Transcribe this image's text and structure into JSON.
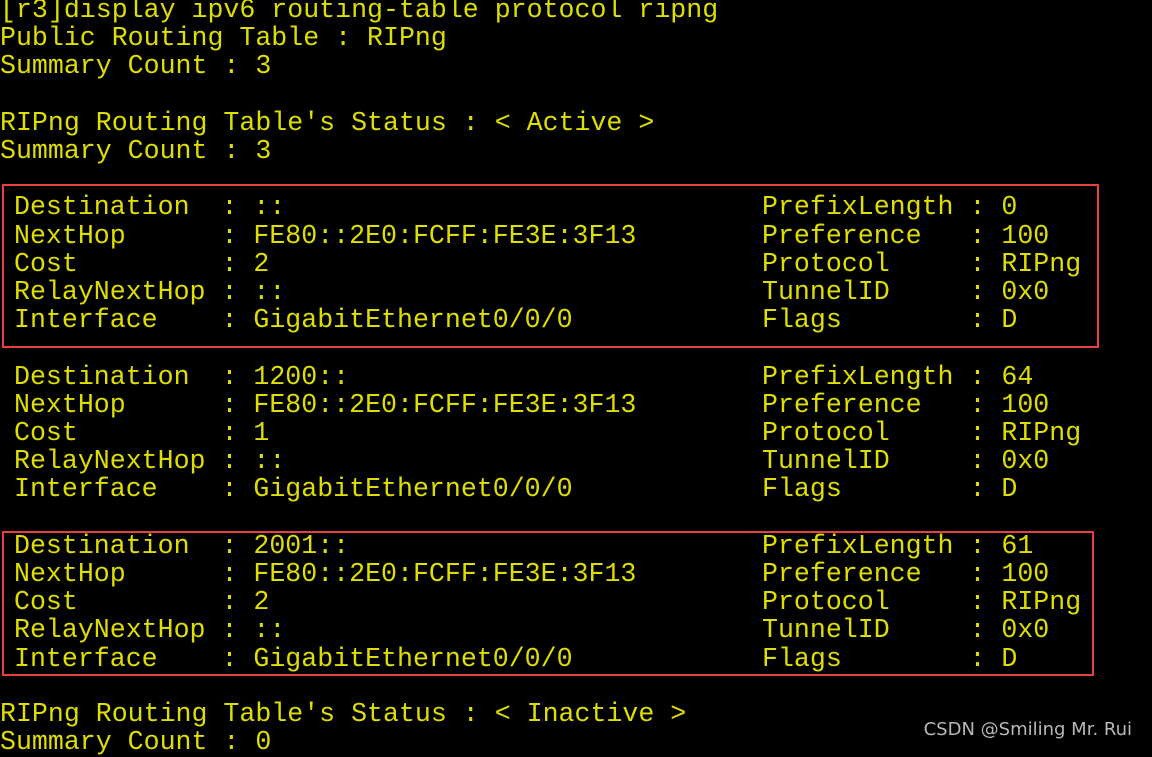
{
  "terminal": {
    "text_color": "#dede00",
    "background": "#000000",
    "highlight_box_color": "#e8403c",
    "command": "[r3]display ipv6 routing-table protocol ripng",
    "public_table": "Public Routing Table : RIPng",
    "summary_total": "Summary Count : 3",
    "active_status": "RIPng Routing Table's Status : < Active >",
    "active_summary": "Summary Count : 3",
    "inactive_status": "RIPng Routing Table's Status : < Inactive >",
    "inactive_summary": "Summary Count : 0",
    "entries": [
      {
        "highlighted": true,
        "rows": [
          [
            "Destination  : ::",
            "PrefixLength : 0"
          ],
          [
            "NextHop      : FE80::2E0:FCFF:FE3E:3F13",
            "Preference   : 100"
          ],
          [
            "Cost         : 2",
            "Protocol     : RIPng"
          ],
          [
            "RelayNextHop : ::",
            "TunnelID     : 0x0"
          ],
          [
            "Interface    : GigabitEthernet0/0/0",
            "Flags        : D"
          ]
        ]
      },
      {
        "highlighted": false,
        "rows": [
          [
            "Destination  : 1200::",
            "PrefixLength : 64"
          ],
          [
            "NextHop      : FE80::2E0:FCFF:FE3E:3F13",
            "Preference   : 100"
          ],
          [
            "Cost         : 1",
            "Protocol     : RIPng"
          ],
          [
            "RelayNextHop : ::",
            "TunnelID     : 0x0"
          ],
          [
            "Interface    : GigabitEthernet0/0/0",
            "Flags        : D"
          ]
        ]
      },
      {
        "highlighted": true,
        "rows": [
          [
            "Destination  : 2001::",
            "PrefixLength : 61"
          ],
          [
            "NextHop      : FE80::2E0:FCFF:FE3E:3F13",
            "Preference   : 100"
          ],
          [
            "Cost         : 2",
            "Protocol     : RIPng"
          ],
          [
            "RelayNextHop : ::",
            "TunnelID     : 0x0"
          ],
          [
            "Interface    : GigabitEthernet0/0/0",
            "Flags        : D"
          ]
        ]
      }
    ]
  },
  "watermark": "CSDN @Smiling Mr. Rui"
}
